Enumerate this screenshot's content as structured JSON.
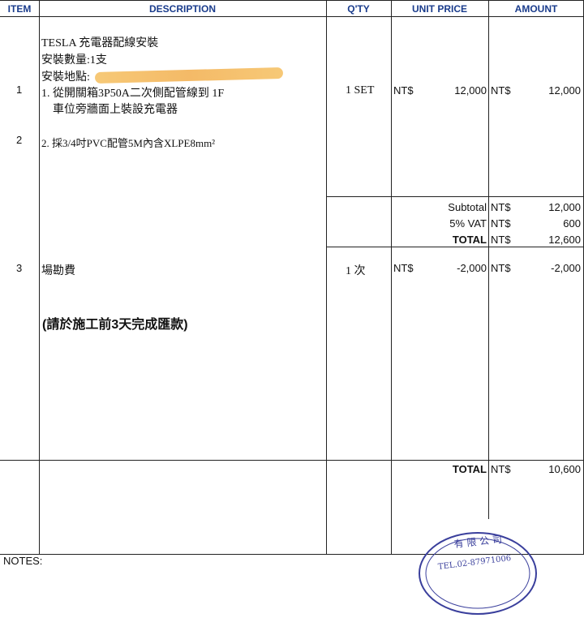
{
  "header": {
    "item": "ITEM",
    "description": "DESCRIPTION",
    "qty": "Q'TY",
    "unit_price": "UNIT PRICE",
    "amount": "AMOUNT"
  },
  "items": [
    {
      "no": "1",
      "desc_lines": [
        "TESLA  充電器配線安裝",
        "安裝數量:1支",
        "安裝地點:",
        "1. 從開關箱3P50A二次側配管線到 1F",
        "車位旁牆面上裝設充電器"
      ],
      "qty": "1 SET",
      "currency": "NT$",
      "unit_price": "12,000",
      "amount_currency": "NT$",
      "amount": "12,000"
    },
    {
      "no": "2",
      "desc_lines": [
        "2. 採3/4吋PVC配管5M內含XLPE8mm²"
      ]
    },
    {
      "no": "3",
      "desc_lines": [
        "場勘費"
      ],
      "qty": "1 次",
      "currency": "NT$",
      "unit_price": "-2,000",
      "amount_currency": "NT$",
      "amount": "-2,000"
    }
  ],
  "subtotals": {
    "subtotal_label": "Subtotal",
    "subtotal_currency": "NT$",
    "subtotal_value": "12,000",
    "vat_label": "5% VAT",
    "vat_currency": "NT$",
    "vat_value": "600",
    "total_label": "TOTAL",
    "total_currency": "NT$",
    "total_value": "12,600"
  },
  "note_payment": "(請於施工前3天完成匯款)",
  "grand_total": {
    "label": "TOTAL",
    "currency": "NT$",
    "value": "10,600"
  },
  "notes_label": "NOTES:",
  "stamp": {
    "text_top": "有 限 公 司",
    "tel": "TEL.02-87971006",
    "color": "#3a3f9c"
  },
  "colors": {
    "header_text": "#1a3c8c",
    "redaction": "#f3b45a"
  }
}
